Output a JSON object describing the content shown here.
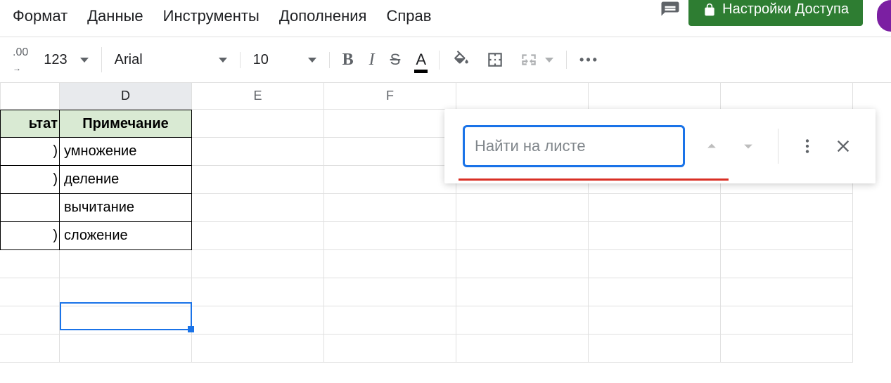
{
  "menubar": {
    "format": "Формат",
    "data": "Данные",
    "tools": "Инструменты",
    "addons": "Дополнения",
    "help": "Справ"
  },
  "share": {
    "label": "Настройки Доступа"
  },
  "toolbar": {
    "precision": ".00",
    "numfmt": "123",
    "font": "Arial",
    "fontsize": "10",
    "bold": "B",
    "italic": "I",
    "strike": "S",
    "textcolor": "A"
  },
  "columns": {
    "d": "D",
    "e": "E",
    "f": "F"
  },
  "sheet": {
    "header_c": "ьтат",
    "header_d": "Примечание",
    "rows": [
      {
        "c": ")",
        "d": "умножение"
      },
      {
        "c": ")",
        "d": "деление"
      },
      {
        "c": "",
        "d": "вычитание"
      },
      {
        "c": ")",
        "d": "сложение"
      }
    ]
  },
  "find": {
    "placeholder": "Найти на листе"
  }
}
